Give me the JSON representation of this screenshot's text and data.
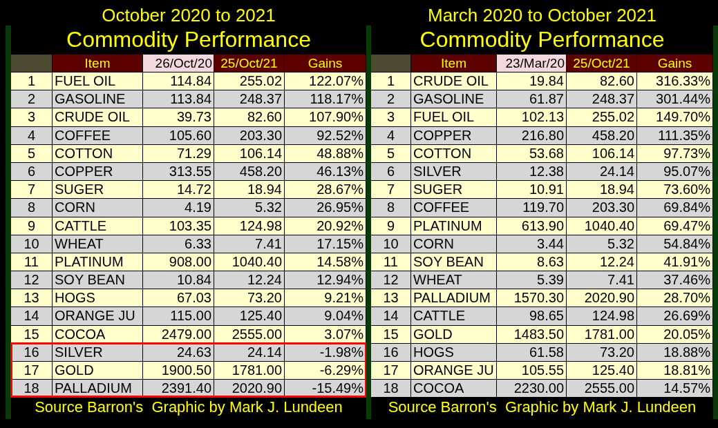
{
  "panels": [
    {
      "title": "October 2020 to 2021",
      "subtitle": "Commodity Performance",
      "columns": [
        {
          "label": "Item",
          "kind": "dark"
        },
        {
          "label": "26/Oct/20",
          "kind": "light"
        },
        {
          "label": "25/Oct/21",
          "kind": "dark"
        },
        {
          "label": "Gains",
          "kind": "dark"
        }
      ],
      "rows": [
        {
          "rank": "1",
          "item": "FUEL OIL",
          "start": "114.84",
          "end": "255.02",
          "gain": "122.07%",
          "highlighted": false
        },
        {
          "rank": "2",
          "item": "GASOLINE",
          "start": "113.84",
          "end": "248.37",
          "gain": "118.17%",
          "highlighted": false
        },
        {
          "rank": "3",
          "item": "CRUDE OIL",
          "start": "39.73",
          "end": "82.60",
          "gain": "107.90%",
          "highlighted": false
        },
        {
          "rank": "4",
          "item": "COFFEE",
          "start": "105.60",
          "end": "203.30",
          "gain": "92.52%",
          "highlighted": false
        },
        {
          "rank": "5",
          "item": "COTTON",
          "start": "71.29",
          "end": "106.14",
          "gain": "48.88%",
          "highlighted": false
        },
        {
          "rank": "6",
          "item": "COPPER",
          "start": "313.55",
          "end": "458.20",
          "gain": "46.13%",
          "highlighted": false
        },
        {
          "rank": "7",
          "item": "SUGER",
          "start": "14.72",
          "end": "18.94",
          "gain": "28.67%",
          "highlighted": false
        },
        {
          "rank": "8",
          "item": "CORN",
          "start": "4.19",
          "end": "5.32",
          "gain": "26.95%",
          "highlighted": false
        },
        {
          "rank": "9",
          "item": "CATTLE",
          "start": "103.35",
          "end": "124.98",
          "gain": "20.92%",
          "highlighted": false
        },
        {
          "rank": "10",
          "item": "WHEAT",
          "start": "6.33",
          "end": "7.41",
          "gain": "17.15%",
          "highlighted": false
        },
        {
          "rank": "11",
          "item": "PLATINUM",
          "start": "908.00",
          "end": "1040.40",
          "gain": "14.58%",
          "highlighted": false
        },
        {
          "rank": "12",
          "item": "SOY BEAN",
          "start": "10.84",
          "end": "12.24",
          "gain": "12.94%",
          "highlighted": false
        },
        {
          "rank": "13",
          "item": "HOGS",
          "start": "67.03",
          "end": "73.20",
          "gain": "9.21%",
          "highlighted": false
        },
        {
          "rank": "14",
          "item": "ORANGE JU",
          "start": "115.00",
          "end": "125.40",
          "gain": "9.04%",
          "highlighted": false
        },
        {
          "rank": "15",
          "item": "COCOA",
          "start": "2479.00",
          "end": "2555.00",
          "gain": "3.07%",
          "highlighted": false
        },
        {
          "rank": "16",
          "item": "SILVER",
          "start": "24.63",
          "end": "24.14",
          "gain": "-1.98%",
          "highlighted": true
        },
        {
          "rank": "17",
          "item": "GOLD",
          "start": "1900.50",
          "end": "1781.00",
          "gain": "-6.29%",
          "highlighted": true
        },
        {
          "rank": "18",
          "item": "PALLADIUM",
          "start": "2391.40",
          "end": "2020.90",
          "gain": "-15.49%",
          "highlighted": true
        }
      ],
      "footer": "Source Barron's  Graphic by Mark J. Lundeen"
    },
    {
      "title": "March 2020 to October 2021",
      "subtitle": "Commodity Performance",
      "columns": [
        {
          "label": "Item",
          "kind": "dark"
        },
        {
          "label": "23/Mar/20",
          "kind": "light"
        },
        {
          "label": "25/Oct/21",
          "kind": "dark"
        },
        {
          "label": "Gains",
          "kind": "dark"
        }
      ],
      "rows": [
        {
          "rank": "1",
          "item": "CRUDE OIL",
          "start": "19.84",
          "end": "82.60",
          "gain": "316.33%",
          "highlighted": false
        },
        {
          "rank": "2",
          "item": "GASOLINE",
          "start": "61.87",
          "end": "248.37",
          "gain": "301.44%",
          "highlighted": false
        },
        {
          "rank": "3",
          "item": "FUEL OIL",
          "start": "102.13",
          "end": "255.02",
          "gain": "149.70%",
          "highlighted": false
        },
        {
          "rank": "4",
          "item": "COPPER",
          "start": "216.80",
          "end": "458.20",
          "gain": "111.35%",
          "highlighted": false
        },
        {
          "rank": "5",
          "item": "COTTON",
          "start": "53.68",
          "end": "106.14",
          "gain": "97.73%",
          "highlighted": false
        },
        {
          "rank": "6",
          "item": "SILVER",
          "start": "12.38",
          "end": "24.14",
          "gain": "95.07%",
          "highlighted": false
        },
        {
          "rank": "7",
          "item": "SUGER",
          "start": "10.91",
          "end": "18.94",
          "gain": "73.60%",
          "highlighted": false
        },
        {
          "rank": "8",
          "item": "COFFEE",
          "start": "119.70",
          "end": "203.30",
          "gain": "69.84%",
          "highlighted": false
        },
        {
          "rank": "9",
          "item": "PLATINUM",
          "start": "613.90",
          "end": "1040.40",
          "gain": "69.47%",
          "highlighted": false
        },
        {
          "rank": "10",
          "item": "CORN",
          "start": "3.44",
          "end": "5.32",
          "gain": "54.84%",
          "highlighted": false
        },
        {
          "rank": "11",
          "item": "SOY BEAN",
          "start": "8.63",
          "end": "12.24",
          "gain": "41.91%",
          "highlighted": false
        },
        {
          "rank": "12",
          "item": "WHEAT",
          "start": "5.39",
          "end": "7.41",
          "gain": "37.46%",
          "highlighted": false
        },
        {
          "rank": "13",
          "item": "PALLADIUM",
          "start": "1570.30",
          "end": "2020.90",
          "gain": "28.70%",
          "highlighted": false
        },
        {
          "rank": "14",
          "item": "CATTLE",
          "start": "98.65",
          "end": "124.98",
          "gain": "26.69%",
          "highlighted": false
        },
        {
          "rank": "15",
          "item": "GOLD",
          "start": "1483.50",
          "end": "1781.00",
          "gain": "20.05%",
          "highlighted": false
        },
        {
          "rank": "16",
          "item": "HOGS",
          "start": "61.58",
          "end": "73.20",
          "gain": "18.88%",
          "highlighted": false
        },
        {
          "rank": "17",
          "item": "ORANGE JU",
          "start": "105.55",
          "end": "125.40",
          "gain": "18.81%",
          "highlighted": false
        },
        {
          "rank": "18",
          "item": "COCOA",
          "start": "2230.00",
          "end": "2555.00",
          "gain": "14.57%",
          "highlighted": false
        }
      ],
      "footer": "Source Barron's  Graphic by Mark J. Lundeen"
    }
  ]
}
